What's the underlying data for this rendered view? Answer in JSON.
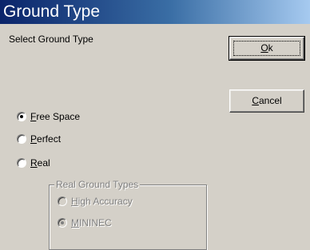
{
  "window": {
    "title": "Ground Type"
  },
  "prompt": "Select Ground Type",
  "buttons": {
    "ok": {
      "mnemonic": "O",
      "rest": "k"
    },
    "cancel": {
      "mnemonic": "C",
      "rest": "ancel"
    }
  },
  "ground_options": [
    {
      "mnemonic": "F",
      "rest": "ree Space",
      "checked": true
    },
    {
      "mnemonic": "P",
      "rest": "erfect",
      "checked": false
    },
    {
      "mnemonic": "R",
      "rest": "eal",
      "checked": false
    }
  ],
  "real_ground": {
    "legend": "Real Ground Types",
    "options": [
      {
        "mnemonic": "H",
        "rest": "igh Accuracy",
        "checked": false
      },
      {
        "mnemonic": "M",
        "rest": "ININEC",
        "checked": true
      }
    ]
  }
}
